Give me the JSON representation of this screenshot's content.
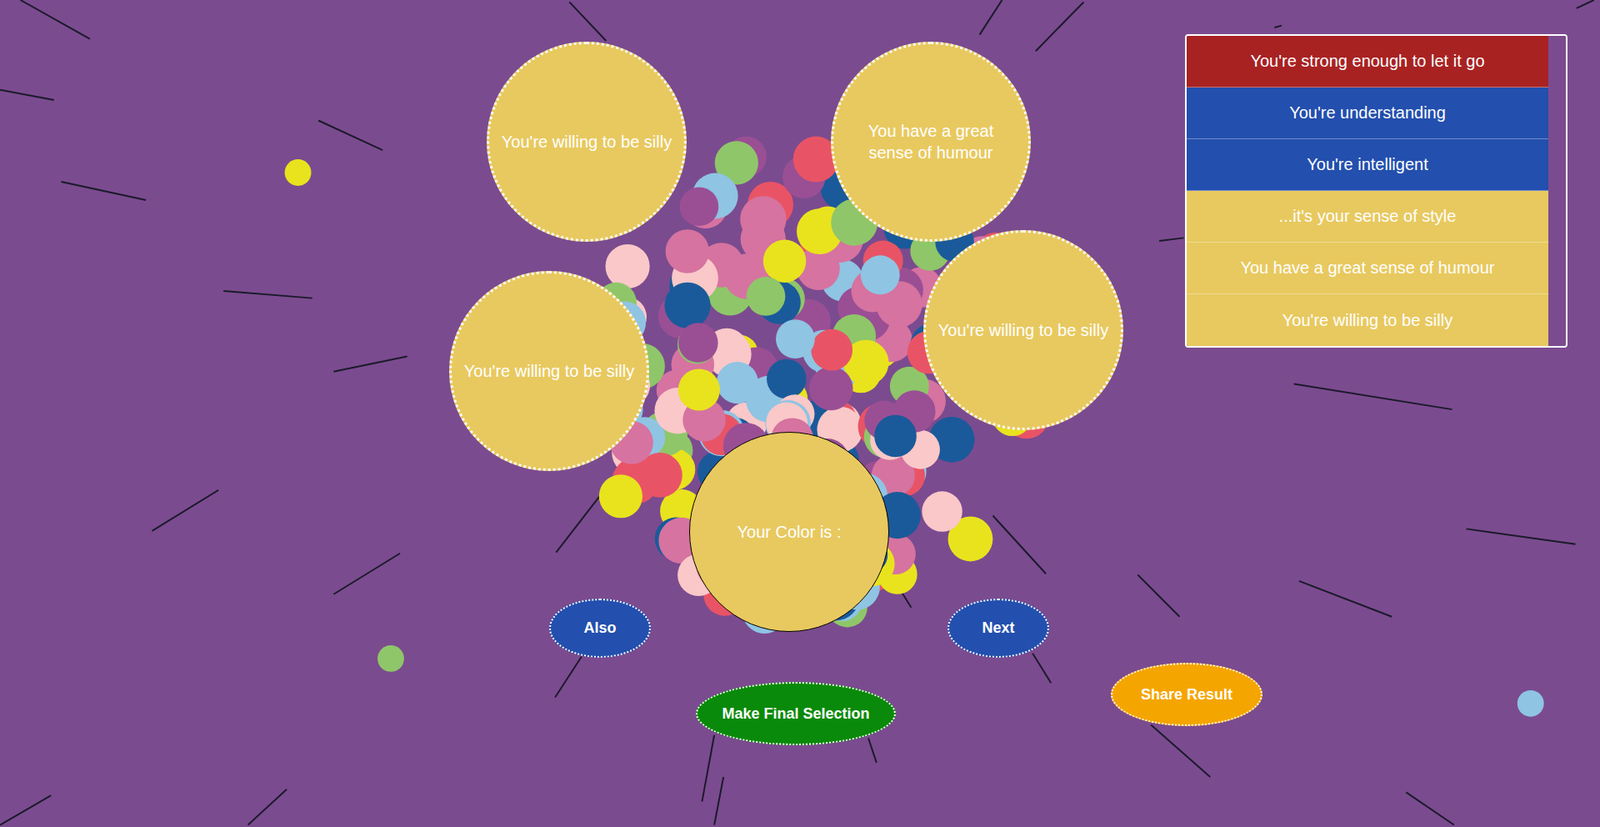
{
  "options": [
    {
      "text": "You're willing to be silly",
      "color": "#e8c95f"
    },
    {
      "text": "You have a great sense of humour",
      "color": "#e8c95f"
    },
    {
      "text": "You're willing to be silly",
      "color": "#e8c95f"
    },
    {
      "text": "You're willing to be silly",
      "color": "#e8c95f"
    }
  ],
  "result": {
    "label": "Your Color is :",
    "color": "#e8c95f"
  },
  "buttons": {
    "also": "Also",
    "next": "Next",
    "final": "Make Final Selection",
    "share": "Share Result"
  },
  "history": [
    {
      "text": "You're strong enough to let it go",
      "color": "#a82222"
    },
    {
      "text": "You're understanding",
      "color": "#234fae"
    },
    {
      "text": "You're intelligent",
      "color": "#234fae"
    },
    {
      "text": "...it's your sense of style",
      "color": "#e8c95f"
    },
    {
      "text": "You have a great sense of humour",
      "color": "#e8c95f"
    },
    {
      "text": "You're willing to be silly",
      "color": "#e8c95f"
    }
  ]
}
